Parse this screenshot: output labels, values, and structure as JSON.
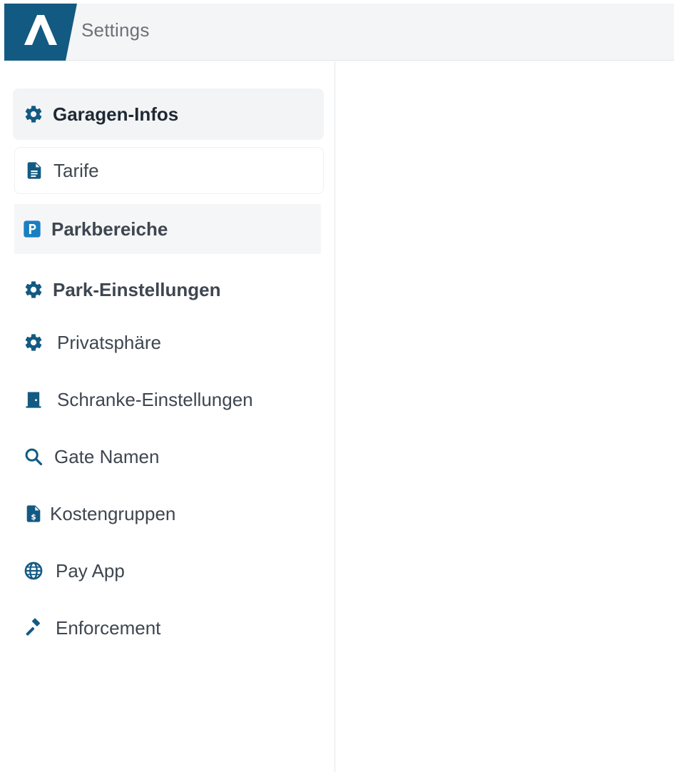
{
  "header": {
    "title": "Settings",
    "logo_icon": "brand-a-logo",
    "brand_color": "#135a82"
  },
  "sidebar": {
    "items": [
      {
        "label": "Garagen-Infos",
        "icon": "gear-icon",
        "state": "active"
      },
      {
        "label": "Tarife",
        "icon": "document-icon"
      },
      {
        "label": "Parkbereiche",
        "icon": "parking-icon"
      },
      {
        "label": "Park-Einstellungen",
        "icon": "gear-icon"
      },
      {
        "label": "Privatsphäre",
        "icon": "gear-icon"
      },
      {
        "label": "Schranke-Einstellungen",
        "icon": "door-icon"
      },
      {
        "label": "Gate Namen",
        "icon": "search-icon"
      },
      {
        "label": "Kostengruppen",
        "icon": "invoice-dollar-icon"
      },
      {
        "label": "Pay App",
        "icon": "globe-icon"
      },
      {
        "label": "Enforcement",
        "icon": "gavel-icon"
      }
    ]
  },
  "colors": {
    "icon": "#135a82",
    "text": "#3e4650",
    "active_bg": "#f3f4f6"
  }
}
